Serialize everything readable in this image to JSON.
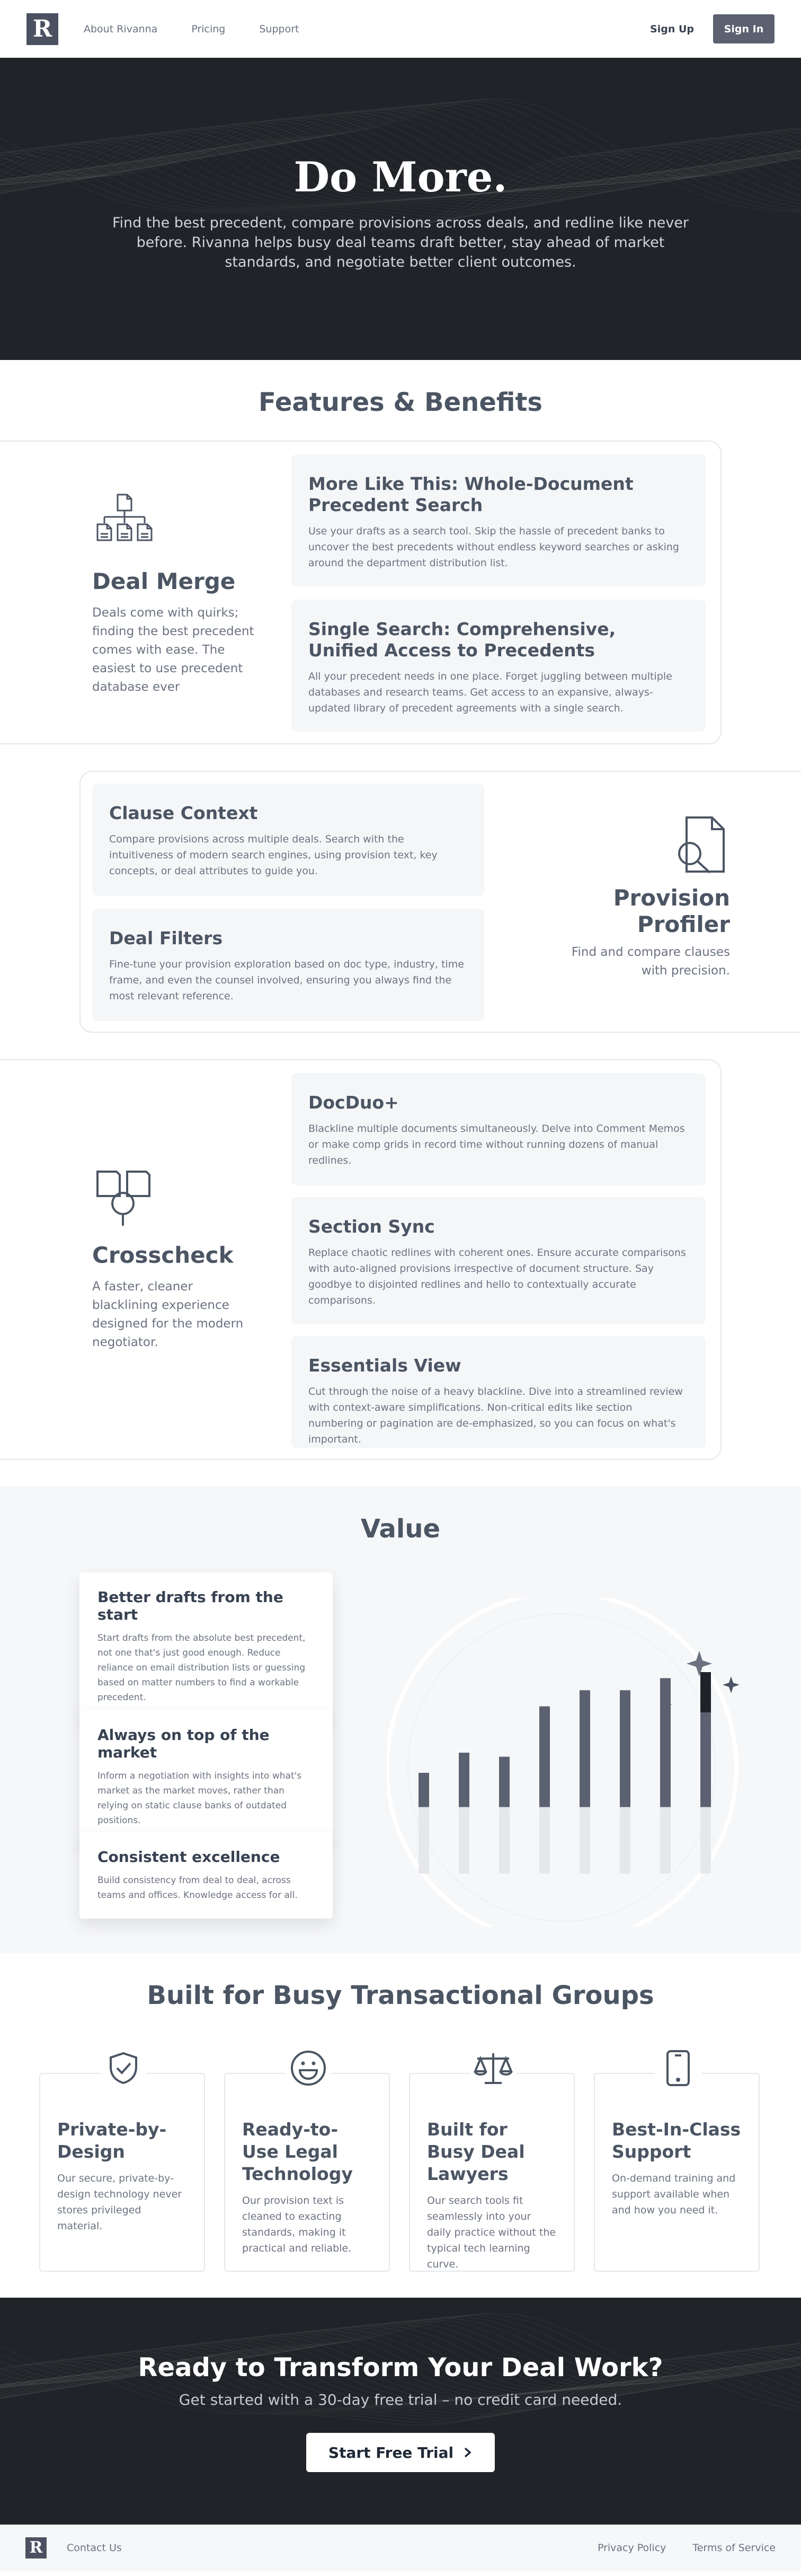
{
  "nav": {
    "logo": "R",
    "links": [
      "About Rivanna",
      "Pricing",
      "Support"
    ],
    "sign_up": "Sign Up",
    "sign_in": "Sign In"
  },
  "hero": {
    "title": "Do More.",
    "subtitle": "Find the best precedent, compare provisions across deals, and redline like never before. Rivanna helps busy deal teams draft better, stay ahead of market standards, and negotiate better client outcomes."
  },
  "features": {
    "title": "Features & Benefits",
    "deal_merge": {
      "icon": "document-tree-icon",
      "title": "Deal Merge",
      "description": "Deals come with quirks; finding the best precedent comes with ease. The easiest to use precedent database ever",
      "cards": [
        {
          "title": "More Like This: Whole-Document Precedent Search",
          "text": "Use your drafts as a search tool. Skip the hassle of precedent banks to uncover the best precedents without endless keyword searches or asking around the department distribution list."
        },
        {
          "title": "Single Search: Comprehensive, Unified Access to Precedents",
          "text": "All your precedent needs in one place. Forget juggling between multiple databases and research teams. Get access to an expansive, always-updated library of precedent agreements with a single search."
        }
      ]
    },
    "provision_profiler": {
      "icon": "document-search-icon",
      "title": "Provision Profiler",
      "description": "Find and compare clauses with precision.",
      "cards": [
        {
          "title": "Clause Context",
          "text": "Compare provisions across multiple deals. Search with the intuitiveness of modern search engines, using provision text, key concepts, or deal attributes to guide you."
        },
        {
          "title": "Deal Filters",
          "text": "Fine-tune your provision exploration based on doc type, industry, time frame, and even the counsel involved, ensuring you always find the most relevant reference."
        }
      ]
    },
    "crosscheck": {
      "icon": "documents-magnify-icon",
      "title": "Crosscheck",
      "description": "A faster, cleaner blacklining experience designed for the modern negotiator.",
      "cards": [
        {
          "title": "DocDuo+",
          "text": "Blackline multiple documents simultaneously. Delve into Comment Memos or make comp grids in record time without running dozens of manual redlines."
        },
        {
          "title": "Section Sync",
          "text": "Replace chaotic redlines with coherent ones. Ensure accurate comparisons with auto-aligned provisions irrespective of document structure. Say goodbye to disjointed redlines and hello to contextually accurate comparisons."
        },
        {
          "title": "Essentials View",
          "text": "Cut through the noise of a heavy blackline. Dive into a streamlined review with context-aware simplifications. Non-critical edits like section numbering or pagination are de-emphasized, so you can focus on what's important."
        }
      ]
    }
  },
  "value": {
    "title": "Value",
    "cards": [
      {
        "title": "Better drafts from the start",
        "text": "Start drafts from the absolute best precedent, not one that's just good enough. Reduce reliance on email distribution lists or guessing based on matter numbers to find a workable precedent."
      },
      {
        "title": "Always on top of the market",
        "text": "Inform a negotiation with insights into what's market as the market moves, rather than relying on static clause banks of outdated positions."
      },
      {
        "title": "Consistent excellence",
        "text": "Build consistency from deal to deal, across teams and offices. Knowledge access for all."
      }
    ],
    "bars": [
      {
        "base": 0.33,
        "mid": 0.5
      },
      {
        "base": 0.33,
        "mid": 0.6
      },
      {
        "base": 0.33,
        "mid": 0.58
      },
      {
        "base": 0.33,
        "mid": 0.83
      },
      {
        "base": 0.33,
        "mid": 0.91
      },
      {
        "base": 0.33,
        "mid": 0.91
      },
      {
        "base": 0.33,
        "mid": 0.97
      },
      {
        "base": 0.33,
        "mid": 0.8,
        "top": 1.0
      }
    ]
  },
  "built": {
    "title": "Built for Busy Transactional Groups",
    "cards": [
      {
        "icon": "shield-check-icon",
        "title": "Private-by-Design",
        "text": "Our secure, private-by-design technology never stores privileged material."
      },
      {
        "icon": "smile-icon",
        "title": "Ready-to-Use Legal Technology",
        "text": "Our provision text is cleaned to exacting standards, making it practical and reliable."
      },
      {
        "icon": "scales-icon",
        "title": "Built for Busy Deal Lawyers",
        "text": "Our search tools fit seamlessly into your daily practice without the typical tech learning curve."
      },
      {
        "icon": "phone-icon",
        "title": "Best-In-Class Support",
        "text": "On-demand training and support available when and how you need it."
      }
    ]
  },
  "cta": {
    "title": "Ready to Transform Your Deal Work?",
    "subtitle": "Get started with a 30-day free trial – no credit card needed.",
    "button": "Start Free Trial"
  },
  "footer": {
    "logo": "R",
    "contact": "Contact Us",
    "privacy": "Privacy Policy",
    "terms": "Terms of Service"
  }
}
